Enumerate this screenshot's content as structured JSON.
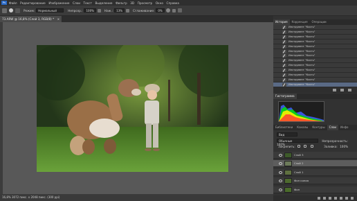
{
  "menu": [
    "Файл",
    "Редактирование",
    "Изображение",
    "Слои",
    "Текст",
    "Выделение",
    "Фильтр",
    "3D",
    "Просмотр",
    "Окно",
    "Справка"
  ],
  "options": {
    "mode_label": "Режим:",
    "mode_value": "Нормальный",
    "opacity_label": "Непрозр.:",
    "opacity_value": "100%",
    "flow_label": "Наж.:",
    "flow_value": "13%",
    "smooth_label": "Сглаживание:",
    "smooth_value": "0%"
  },
  "document": {
    "tab_title": "73.ARW @ 16,8% (Слой 3, RGB/8) *"
  },
  "status": {
    "text": "16,8%   3072 пикс. x 2048 пикс. (300 ppi)"
  },
  "history": {
    "tabs": [
      "История",
      "Коррекция",
      "Операции"
    ],
    "items": [
      "Инструмент \"Кисть\"",
      "Инструмент \"Кисть\"",
      "Инструмент \"Кисть\"",
      "Инструмент \"Кисть\"",
      "Инструмент \"Кисть\"",
      "Инструмент \"Кисть\"",
      "Инструмент \"Кисть\"",
      "Инструмент \"Кисть\"",
      "Инструмент \"Кисть\"",
      "Инструмент \"Кисть\"",
      "Инструмент \"Кисть\"",
      "Инструмент \"Кисть\"",
      "Инструмент \"Кисть\""
    ]
  },
  "histogram": {
    "title": "Гистограмма"
  },
  "layers_panel": {
    "tabs": [
      "Библиотеки",
      "Каналы",
      "Контуры",
      "Слои",
      "Инфо"
    ],
    "filter_label": "Вид",
    "blend_mode": "Обычные",
    "opacity_label": "Непрозрачность:",
    "opacity_value": "100%",
    "lock_label": "Закрепить:",
    "fill_label": "Заливка:",
    "fill_value": "100%",
    "layers": [
      {
        "name": "Слой 3"
      },
      {
        "name": "Слой 2"
      },
      {
        "name": "Слой 1"
      },
      {
        "name": "Фон копия"
      },
      {
        "name": "Фон"
      }
    ]
  },
  "colors": {
    "accent": "#5a6a85",
    "selected_layer": "#5d5d5d"
  }
}
